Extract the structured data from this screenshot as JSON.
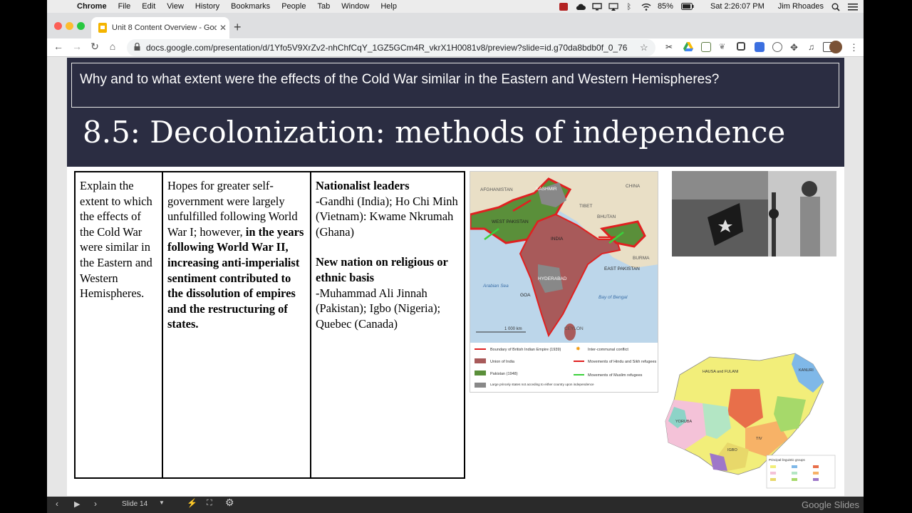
{
  "menubar": {
    "app_name": "Chrome",
    "items": [
      "File",
      "Edit",
      "View",
      "History",
      "Bookmarks",
      "People",
      "Tab",
      "Window",
      "Help"
    ],
    "battery": "85%",
    "clock": "Sat 2:26:07 PM",
    "user": "Jim Rhoades"
  },
  "tab": {
    "title": "Unit 8 Content Overview - Goo",
    "close": "✕",
    "new_tab": "+"
  },
  "toolbar": {
    "url": "docs.google.com/presentation/d/1Yfo5V9XrZv2-nhChfCqY_1GZ5GCm4R_vkrX1H0081v8/preview?slide=id.g70da8bdb0f_0_76"
  },
  "slide": {
    "question": "Why and to what extent were the effects of the Cold War similar in the Eastern and Western Hemispheres?",
    "title": "8.5: Decolonization: methods of independence",
    "col1": "Explain the extent to which the effects of the Cold War were similar in the Eastern and Western Hemispheres.",
    "col2_plain": "Hopes for greater self-government were largely unfulfilled following World War I; however, ",
    "col2_bold": "in the years following World War II, increasing anti-imperialist sentiment contributed to the dissolution of empires and the restructuring of states.",
    "col3": {
      "heading1": "Nationalist leaders",
      "text1": "-Gandhi (India); Ho Chi Minh (Vietnam): Kwame Nkrumah (Ghana)",
      "heading2": "New nation on religious or ethnic basis",
      "text2": "-Muhammad Ali Jinnah (Pakistan); Igbo (Nigeria); Quebec (Canada)"
    }
  },
  "map_india": {
    "labels": {
      "afghanistan": "AFGHANISTAN",
      "kashmir": "KASHMIR",
      "china": "CHINA",
      "tibet": "TIBET",
      "bhutan": "BHUTAN",
      "west_pakistan": "WEST PAKISTAN",
      "india": "INDIA",
      "burma": "BURMA",
      "east_pakistan": "EAST PAKISTAN",
      "hyderabad": "HYDERABAD",
      "arabian_sea": "Arabian Sea",
      "bay_of_bengal": "Bay of Bengal",
      "goa": "GOA",
      "ceylon": "CEYLON",
      "scale": "1 000 km"
    },
    "legend": [
      "Boundary of British Indian Empire (1939)",
      "Union of India",
      "Pakistan (1948)",
      "Large princely states not acceding to either country upon independence",
      "Inter-communal conflict",
      "Movements of Hindu and Sikh refugees",
      "Movements of Muslim refugees"
    ]
  },
  "map_nigeria": {
    "labels": {
      "hausa_fulani": "HAUSA and FULANI",
      "kanuri": "KANURI",
      "yoruba": "YORUBA",
      "igbo": "IGBO",
      "tiv": "TIV",
      "legend_title": "Principal linguistic groups"
    }
  },
  "controls": {
    "slide_label": "Slide 14",
    "branding": "Google Slides"
  },
  "colors": {
    "slide_header": "#2b2d42",
    "india": "#a85a5a",
    "pakistan": "#5a8f3a",
    "boundary": "#e02020"
  }
}
